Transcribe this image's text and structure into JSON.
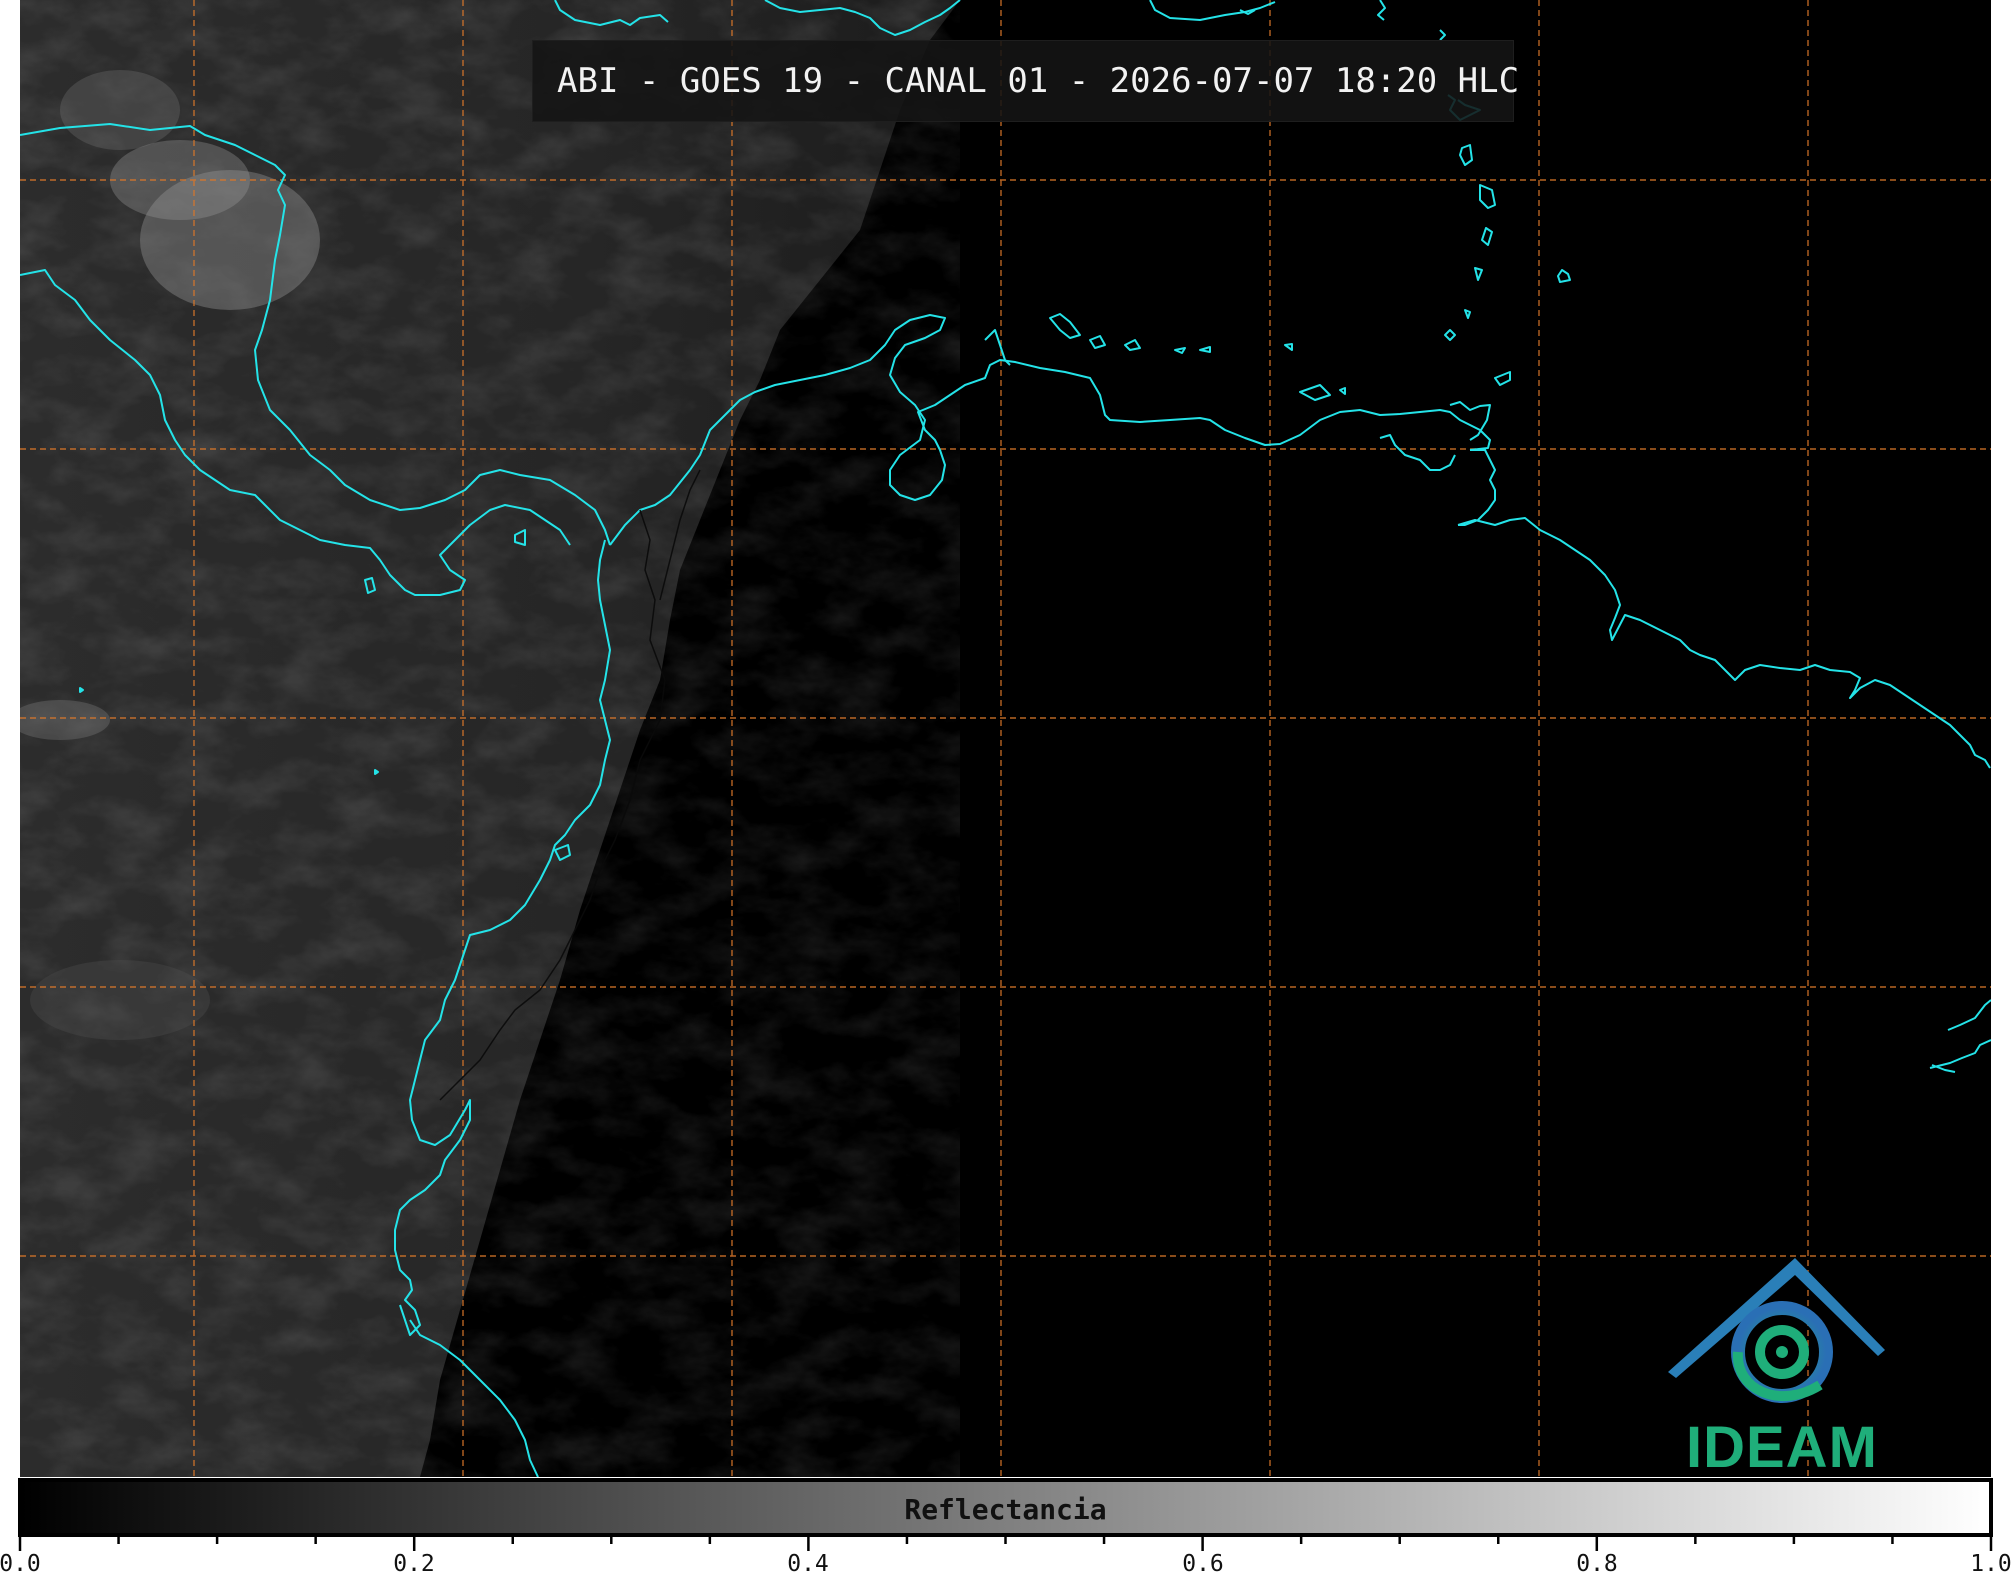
{
  "title": "ABI - GOES 19 - CANAL 01 - 2026-07-07 18:20 HLC",
  "colorbar": {
    "label": "Reflectancia",
    "ticks": [
      "0.0",
      "0.2",
      "0.4",
      "0.6",
      "0.8",
      "1.0"
    ],
    "range": [
      0.0,
      1.0
    ],
    "colormap": "greys (black to white)"
  },
  "logo": {
    "text": "IDEAM"
  },
  "colors": {
    "coastline": "#24e3e8",
    "graticule": "#d9772a",
    "ocean": "#000000",
    "logo_green": "#1fae7a",
    "logo_blue": "#2a6fb5"
  }
}
